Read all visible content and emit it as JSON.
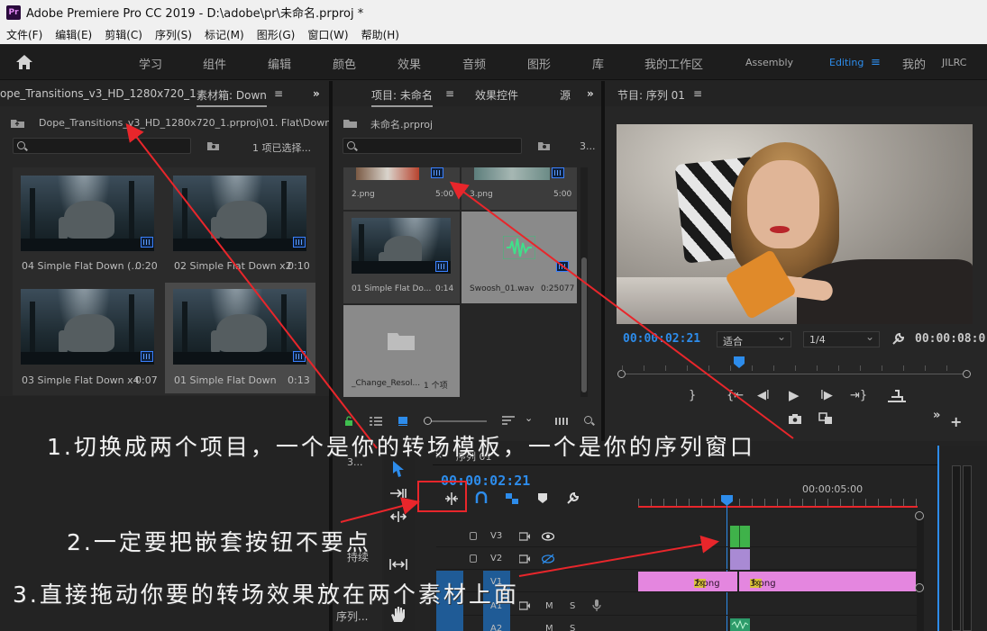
{
  "titlebar": {
    "logo": "Pr",
    "title": "Adobe Premiere Pro CC 2019 - D:\\adobe\\pr\\未命名.prproj *"
  },
  "menu": [
    "文件(F)",
    "编辑(E)",
    "剪辑(C)",
    "序列(S)",
    "标记(M)",
    "图形(G)",
    "窗口(W)",
    "帮助(H)"
  ],
  "workspaces": {
    "items": [
      "学习",
      "组件",
      "编辑",
      "颜色",
      "效果",
      "音频",
      "图形",
      "库",
      "我的工作区",
      "Assembly",
      "Editing",
      "我的",
      "JILRC"
    ],
    "active": "Editing",
    "menu_glyph": "≡"
  },
  "bin_panel": {
    "tab_left": "ope_Transitions_v3_HD_1280x720_1",
    "tab_active": "素材箱: Down",
    "tab_menu": "≡",
    "overflow": "»",
    "path": "Dope_Transitions_v3_HD_1280x720_1.prproj\\01. Flat\\Down",
    "selection_count": "1 项已选择...",
    "clips": [
      {
        "name": "04 Simple Flat Down (...",
        "duration": "0:20"
      },
      {
        "name": "02 Simple Flat Down x2",
        "duration": "0:10"
      },
      {
        "name": "03 Simple Flat Down x4",
        "duration": "0:07"
      },
      {
        "name": "01 Simple Flat Down",
        "duration": "0:13"
      }
    ]
  },
  "project_panel": {
    "tab_active": "项目: 未命名",
    "tab_menu": "≡",
    "tab_effects": "效果控件",
    "tab_more": "源",
    "overflow": "»",
    "project_file": "未命名.prproj",
    "count": "3...",
    "items": [
      {
        "name": "2.png",
        "duration": "5:00"
      },
      {
        "name": "3.png",
        "duration": "5:00"
      },
      {
        "name": "01 Simple Flat Do...",
        "duration": "0:14"
      },
      {
        "name": "Swoosh_01.wav",
        "duration": "0:25077"
      },
      {
        "name": "_Change_Resol...",
        "duration": "1 个项"
      }
    ]
  },
  "program_monitor": {
    "title": "节目: 序列 01",
    "tab_menu": "≡",
    "timecode_current": "00:00:02:21",
    "fit": "适合",
    "resolution": "1/4",
    "timecode_total": "00:00:08:0"
  },
  "timeline": {
    "close": "×",
    "sequence_name": "序列 01",
    "timecode": "00:00:02:21",
    "ruler_mark": "00:00:05:00",
    "tracks": [
      {
        "name": "V3"
      },
      {
        "name": "V2"
      },
      {
        "name": "V1"
      },
      {
        "name": "A1"
      },
      {
        "name": "A2"
      }
    ],
    "clips_v1": [
      {
        "label": "2.png"
      },
      {
        "label": "3.png"
      }
    ],
    "fx_badge": "fx",
    "m_label": "M",
    "s_label": "S"
  },
  "side_panel": {
    "label_top": "3...",
    "label_mid": "持续",
    "label_bottom": "序列..."
  },
  "annotations": {
    "a1": "1.切换成两个项目，一个是你的转场模板，一个是你的序列窗口",
    "a2": "2.一定要把嵌套按钮不要点",
    "a3": "3.直接拖动你要的转场效果放在两个素材上面"
  },
  "colors": {
    "accent": "#2d8ceb",
    "arrow": "#e8262b",
    "clip": "#e486df"
  }
}
